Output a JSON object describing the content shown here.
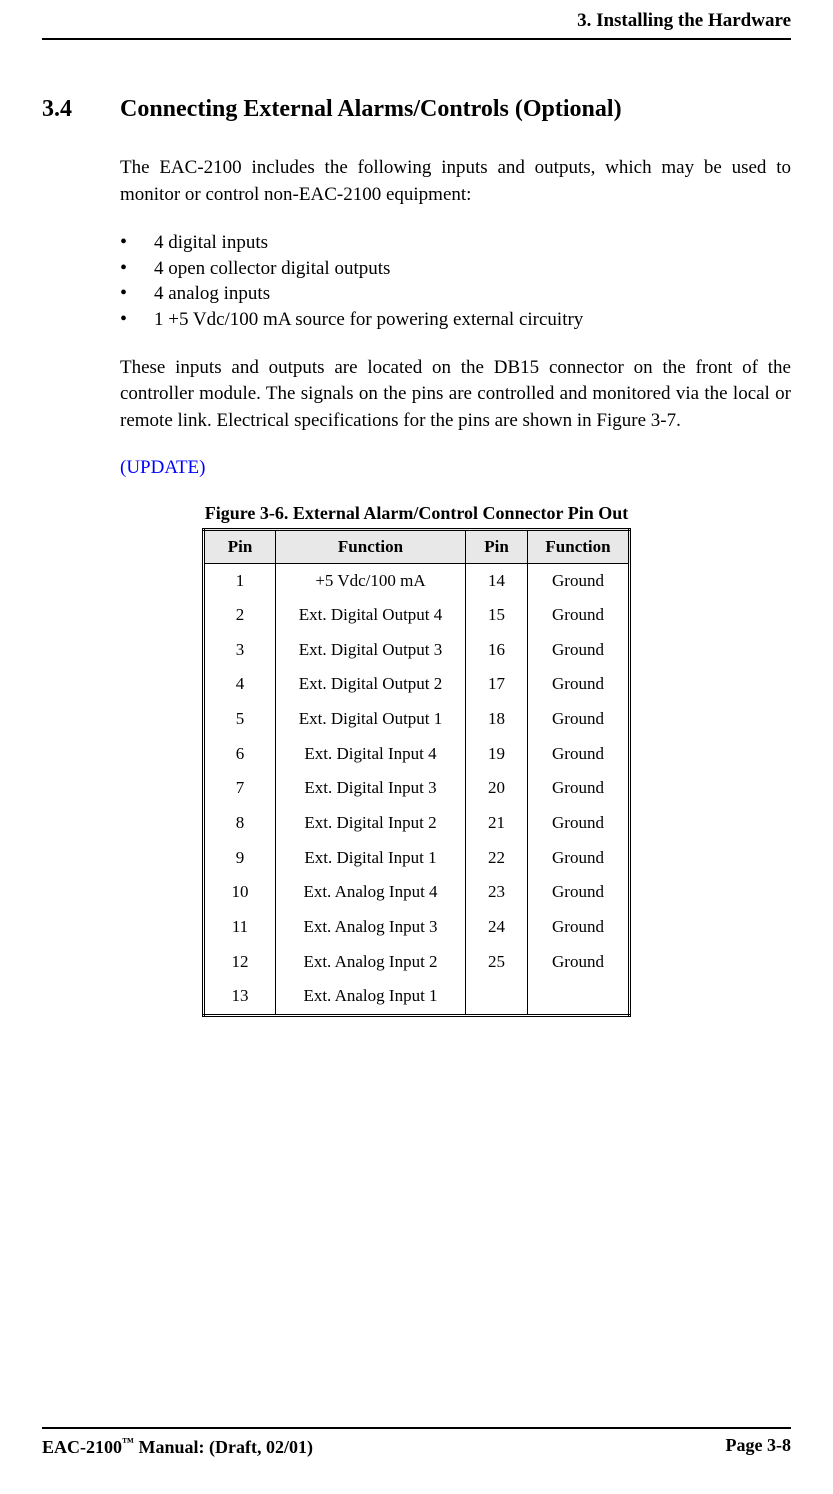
{
  "header": {
    "chapter": "3. Installing the Hardware"
  },
  "section": {
    "number": "3.4",
    "title": "Connecting External Alarms/Controls (Optional)",
    "para1": "The EAC-2100 includes the following inputs and outputs, which may be used to monitor or control non-EAC-2100 equipment:",
    "bullets": [
      "4 digital inputs",
      "4 open collector digital outputs",
      "4 analog inputs",
      "1 +5 Vdc/100 mA source for powering external circuitry"
    ],
    "para2": "These inputs and outputs are located on the DB15 connector on the front of the controller module.  The signals on the pins are controlled and monitored via the local or remote link. Electrical specifications for the pins are shown in Figure 3-7.",
    "update": "(UPDATE)"
  },
  "figure": {
    "caption": "Figure 3-6. External Alarm/Control Connector Pin Out",
    "headers": {
      "pin1": "Pin",
      "func1": "Function",
      "pin2": "Pin",
      "func2": "Function"
    },
    "rows": [
      {
        "pin1": "1",
        "func1": "+5 Vdc/100 mA",
        "pin2": "14",
        "func2": "Ground"
      },
      {
        "pin1": "2",
        "func1": "Ext. Digital Output 4",
        "pin2": "15",
        "func2": "Ground"
      },
      {
        "pin1": "3",
        "func1": "Ext. Digital Output 3",
        "pin2": "16",
        "func2": "Ground"
      },
      {
        "pin1": "4",
        "func1": "Ext. Digital Output 2",
        "pin2": "17",
        "func2": "Ground"
      },
      {
        "pin1": "5",
        "func1": "Ext. Digital Output 1",
        "pin2": "18",
        "func2": "Ground"
      },
      {
        "pin1": "6",
        "func1": "Ext. Digital Input 4",
        "pin2": "19",
        "func2": "Ground"
      },
      {
        "pin1": "7",
        "func1": "Ext. Digital Input 3",
        "pin2": "20",
        "func2": "Ground"
      },
      {
        "pin1": "8",
        "func1": "Ext. Digital Input 2",
        "pin2": "21",
        "func2": "Ground"
      },
      {
        "pin1": "9",
        "func1": "Ext. Digital Input 1",
        "pin2": "22",
        "func2": "Ground"
      },
      {
        "pin1": "10",
        "func1": "Ext. Analog Input 4",
        "pin2": "23",
        "func2": "Ground"
      },
      {
        "pin1": "11",
        "func1": "Ext. Analog Input 3",
        "pin2": "24",
        "func2": "Ground"
      },
      {
        "pin1": "12",
        "func1": "Ext. Analog Input 2",
        "pin2": "25",
        "func2": "Ground"
      },
      {
        "pin1": "13",
        "func1": "Ext. Analog Input 1",
        "pin2": "",
        "func2": ""
      }
    ]
  },
  "footer": {
    "left_prefix": "EAC-2100",
    "tm": "™",
    "left_suffix": " Manual: (Draft, 02/01)",
    "right": "Page 3-8"
  }
}
